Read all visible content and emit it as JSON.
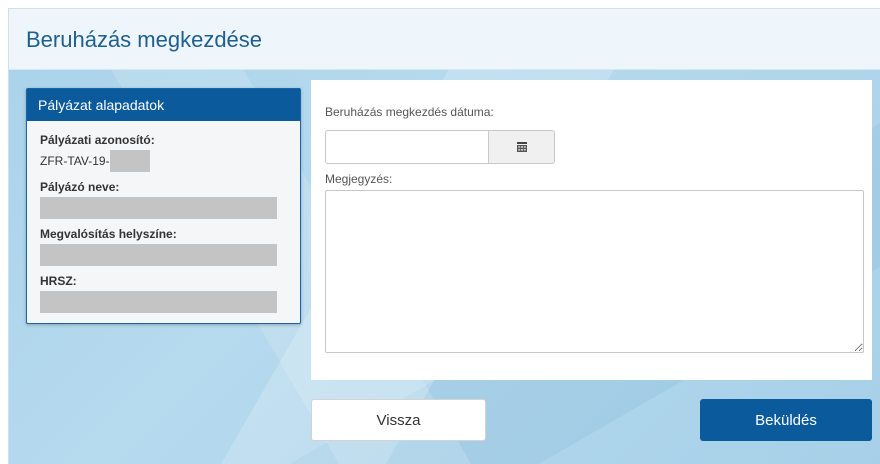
{
  "header": {
    "title": "Beruházás megkezdése"
  },
  "panel": {
    "title": "Pályázat alapadatok",
    "fields": [
      {
        "label": "Pályázati azonosító:",
        "value_prefix": "ZFR-TAV-19-"
      },
      {
        "label": "Pályázó neve:"
      },
      {
        "label": "Megvalósítás helyszíne:"
      },
      {
        "label": "HRSZ:"
      }
    ]
  },
  "form": {
    "date_label": "Beruházás megkezdés dátuma:",
    "date_value": "",
    "calendar_icon": "calendar-icon",
    "note_label": "Megjegyzés:",
    "note_value": ""
  },
  "actions": {
    "back_label": "Vissza",
    "submit_label": "Beküldés"
  },
  "colors": {
    "primary": "#0a5a9c",
    "title_text": "#1f5f8f",
    "header_bg": "#eef6fc",
    "background": "#b0d6ec",
    "redacted": "#c4c4c4"
  }
}
